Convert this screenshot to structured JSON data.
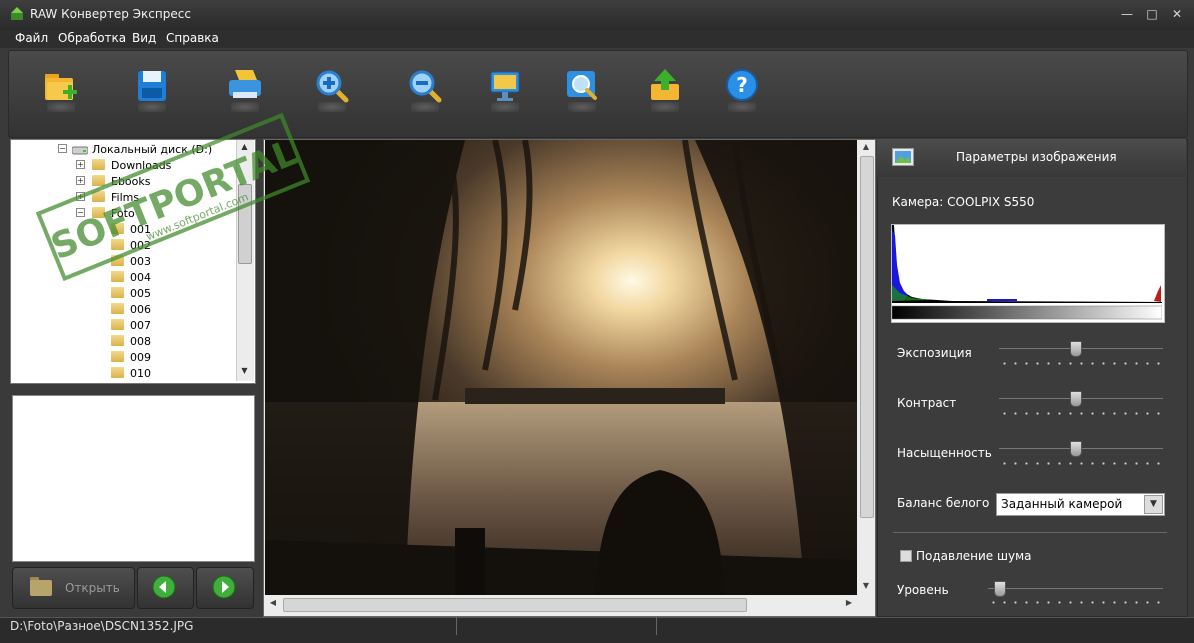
{
  "window": {
    "title": "RAW Конвертер Экспресс",
    "minimize": "—",
    "maximize": "□",
    "close": "✕"
  },
  "menu": [
    "Файл",
    "Обработка",
    "Вид",
    "Справка"
  ],
  "toolbar": {
    "icons": [
      "open-folder-icon",
      "save-icon",
      "print-icon",
      "zoom-in-icon",
      "zoom-out-icon",
      "fit-screen-icon",
      "actual-size-icon",
      "export-icon",
      "help-icon"
    ]
  },
  "tree": {
    "root": "Локальный диск (D:)",
    "nodes": [
      {
        "label": "Downloads",
        "level": 1,
        "expander": "+"
      },
      {
        "label": "Ebooks",
        "level": 1,
        "expander": "+"
      },
      {
        "label": "Films",
        "level": 1,
        "expander": "+"
      },
      {
        "label": "Foto",
        "level": 1,
        "expander": "−"
      },
      {
        "label": "001",
        "level": 2
      },
      {
        "label": "002",
        "level": 2
      },
      {
        "label": "003",
        "level": 2
      },
      {
        "label": "004",
        "level": 2
      },
      {
        "label": "005",
        "level": 2
      },
      {
        "label": "006",
        "level": 2
      },
      {
        "label": "007",
        "level": 2
      },
      {
        "label": "008",
        "level": 2
      },
      {
        "label": "009",
        "level": 2
      },
      {
        "label": "010",
        "level": 2
      }
    ]
  },
  "left_buttons": {
    "open_label": "Открыть",
    "prev_icon": "arrow-left-icon",
    "next_icon": "arrow-right-icon"
  },
  "params": {
    "title": "Параметры изображения",
    "camera": "Камера: COOLPIX S550",
    "sliders": [
      {
        "label": "Экспозиция",
        "value": 0.5
      },
      {
        "label": "Контраст",
        "value": 0.5
      },
      {
        "label": "Насыщенность",
        "value": 0.5
      },
      {
        "label": "Уровень",
        "value": 0.03
      }
    ],
    "white_balance_label": "Баланс белого",
    "white_balance_value": "Заданный камерой",
    "noise_label": "Подавление шума",
    "noise_checked": false
  },
  "status": {
    "path": "D:\\Foto\\Разное\\DSCN1352.JPG"
  },
  "watermark": {
    "brand": "SOFTPORTAL",
    "url": "www.softportal.com"
  }
}
